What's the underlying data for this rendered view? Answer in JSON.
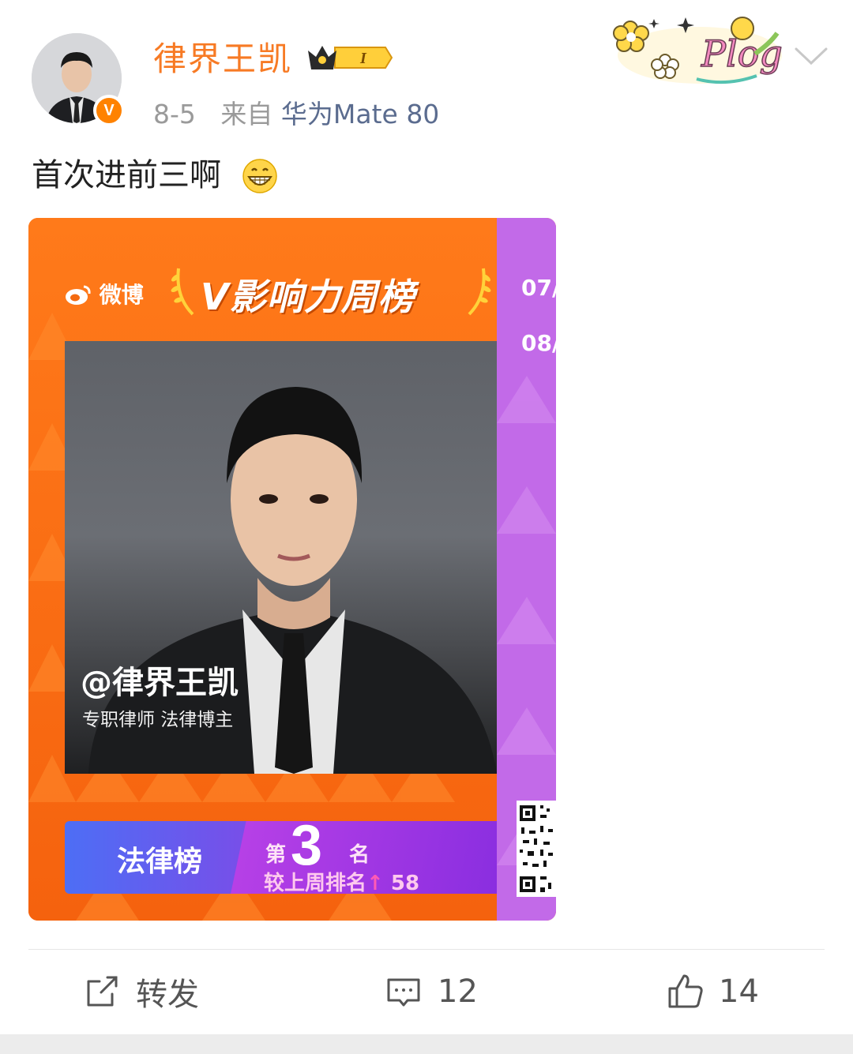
{
  "post": {
    "user": {
      "name": "律界王凯",
      "verified_badge": "V",
      "rank_badge": "I"
    },
    "date": "8-5",
    "source_prefix": "来自",
    "source_device": "华为Mate 80",
    "text": "首次进前三啊",
    "sticker": "Plog"
  },
  "image_card": {
    "brand": "微博",
    "title": "V影响力周榜",
    "dates": [
      "07/",
      "08/"
    ],
    "handle": "@律界王凯",
    "description": "专职律师 法律博主",
    "category": "法律榜",
    "rank_prefix": "第",
    "rank": "3",
    "rank_suffix": "名",
    "compare_label": "较上周排名",
    "compare_arrow": "↑",
    "compare_value": "58"
  },
  "actions": {
    "repost_label": "转发",
    "comment_count": "12",
    "like_count": "14"
  },
  "icons": [
    "crown-icon",
    "chevron-down-icon",
    "repost-icon",
    "comment-icon",
    "like-icon",
    "grin-emoji-icon"
  ],
  "colors": {
    "username": "#f77a24",
    "verified": "#ff8200",
    "source": "#5b6c8f",
    "card_orange": "#f46a10",
    "card_purple": "#c26ae8"
  }
}
